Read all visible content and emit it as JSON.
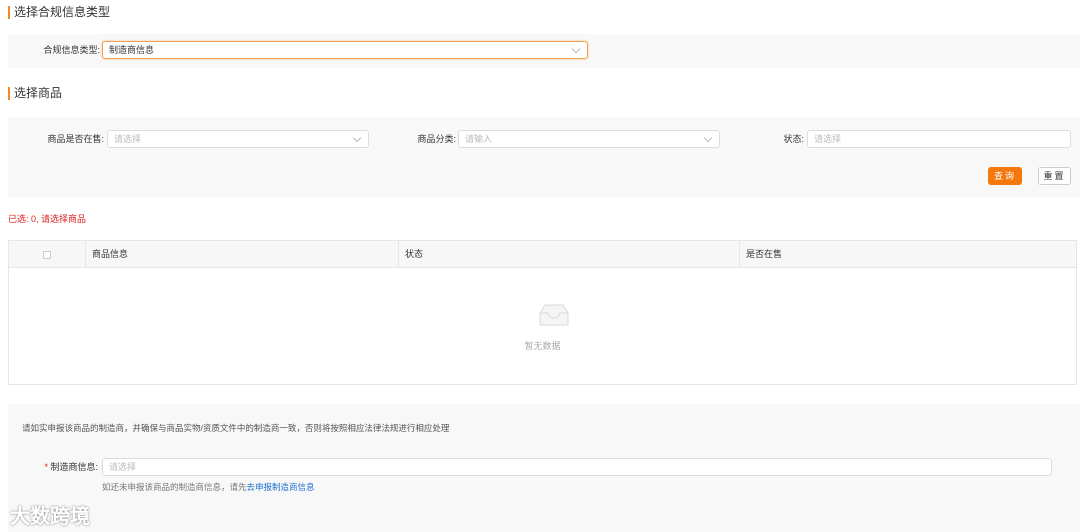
{
  "section1": {
    "title": "选择合规信息类型",
    "type_label": "合规信息类型:",
    "type_value": "制造商信息"
  },
  "section2": {
    "title": "选择商品",
    "on_sale_label": "商品是否在售:",
    "on_sale_placeholder": "请选择",
    "category_label": "商品分类:",
    "category_placeholder": "请输入",
    "status_label": "状态:",
    "status_placeholder": "请选择",
    "query_button": "查询",
    "reset_button": "重置"
  },
  "selected_text": "已选: 0, 请选择商品",
  "table": {
    "columns": [
      "商品信息",
      "状态",
      "是否在售"
    ],
    "empty_text": "暂无数据"
  },
  "manufacturer": {
    "notice": "请如实申报该商品的制造商，并确保与商品实物/资质文件中的制造商一致，否则将按照相应法律法规进行相应处理",
    "required_mark": "*",
    "label": "制造商信息:",
    "placeholder": "请选择",
    "hint": "如还未申报该商品的制造商信息，请先",
    "hint_link": "去申报制造商信息"
  },
  "logo_text": "大数跨境",
  "colors": {
    "accent": "#f5780f",
    "error": "#e02020",
    "link": "#1a6fd0"
  }
}
